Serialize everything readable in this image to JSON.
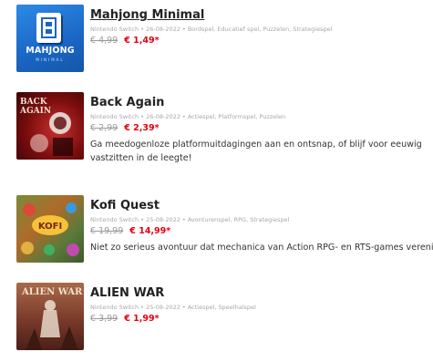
{
  "games": [
    {
      "title": "Mahjong Minimal",
      "meta": "Nintendo Switch • 26-08-2022 • Bordspel, Educatief spel, Puzzelen, Strategiespel",
      "old_price": "€ 4,99",
      "new_price": "€ 1,49*",
      "description": "",
      "thumb_text": "MAHJONG",
      "thumb_sub": "MINIMAL",
      "thumb_icon": "mahjong-tile-icon"
    },
    {
      "title": "Back Again",
      "meta": "Nintendo Switch • 26-08-2022 • Actiespel, Platformspel, Puzzelen",
      "old_price": "€ 2,99",
      "new_price": "€ 2,39*",
      "description_line1": "Ga meedogenloze platformuitdagingen aan en ontsnap, of blijf voor eeuwig",
      "description_line2": "vastzitten in de leegte!",
      "thumb_text": "BACK AGAIN"
    },
    {
      "title": "Kofi Quest",
      "meta": "Nintendo Switch • 25-08-2022 • Avonturenspel, RPG, Strategiespel",
      "old_price": "€ 19,99",
      "new_price": "€ 14,99*",
      "description_line1": "Niet zo serieus avontuur dat mechanica van Action RPG- en RTS-games verenigt."
    },
    {
      "title": "ALIEN WAR",
      "meta": "Nintendo Switch • 25-08-2022 • Actiespel, Speelhalspel",
      "old_price": "€ 3,99",
      "new_price": "€ 1,99*",
      "thumb_text": "ALIEN WAR"
    }
  ],
  "colors": {
    "sale_red": "#e4000f",
    "mahjong_blue": "#1d6fd0",
    "back_again_red": "#8a0d10",
    "alien_war_brown": "#8a4a3a"
  }
}
